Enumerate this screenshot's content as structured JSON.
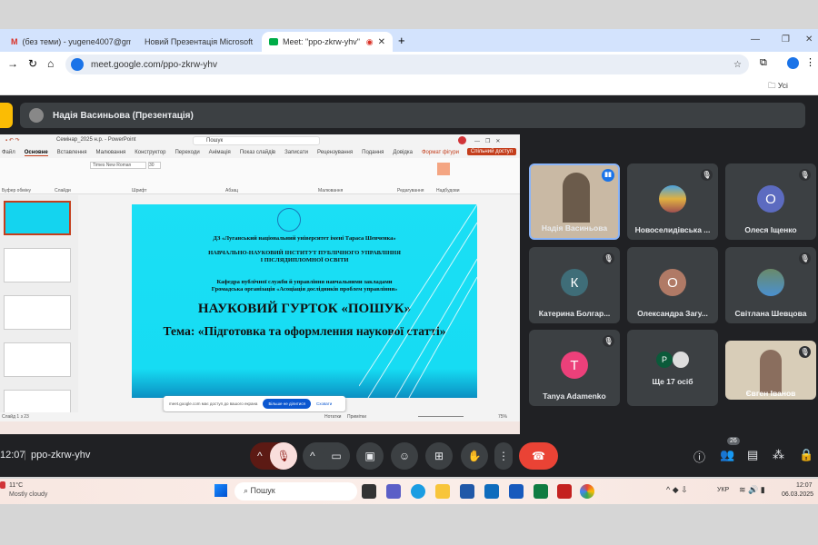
{
  "browser": {
    "tabs": [
      {
        "title": "(без теми) - yugene4007@gma",
        "icon": "gmail-icon"
      },
      {
        "title": "Новий Презентація Microsoft",
        "icon": "slides-icon"
      },
      {
        "title": "Meet: \"ppo-zkrw-yhv\"",
        "icon": "meet-icon",
        "active": true
      }
    ],
    "url": "meet.google.com/ppo-zkrw-yhv",
    "bookmarks_label": "Усі закладки"
  },
  "meet": {
    "presenter_label": "Надія Васиньова (Презентація)",
    "time": "12:07",
    "meeting_code": "ppo-zkrw-yhv",
    "participants_count": "26",
    "participants": [
      {
        "name": "Надія Васиньова",
        "type": "video",
        "speaking": true
      },
      {
        "name": "Новоселидівська ...",
        "type": "photo",
        "muted": true
      },
      {
        "name": "Олеся Іщенко",
        "initial": "О",
        "color": "#5c6bc0",
        "muted": true
      },
      {
        "name": "Катерина Болгар...",
        "initial": "К",
        "color": "#3f6d78",
        "muted": true
      },
      {
        "name": "Олександра Загу...",
        "initial": "О",
        "color": "#b07a66",
        "muted": false
      },
      {
        "name": "Світлана Шевцова",
        "type": "photo",
        "muted": true
      },
      {
        "name": "Tanya Adamenko",
        "initial": "T",
        "color": "#ec407a",
        "muted": true
      },
      {
        "name": "Ще 17 осіб",
        "initial": "P",
        "color": "#0b5a3a"
      },
      {
        "name": "Євген Іванов",
        "type": "video",
        "muted": true
      }
    ]
  },
  "ppt": {
    "title": "Семінар_2025 н.р. - PowerPoint",
    "search": "Пошук",
    "share_button": "Спільний доступ",
    "ribbon_tabs": [
      "Файл",
      "Основне",
      "Вставлення",
      "Малювання",
      "Конструктор",
      "Переходи",
      "Анімація",
      "Показ слайдів",
      "Записати",
      "Рецензування",
      "Подання",
      "Довідка",
      "Формат фігури"
    ],
    "font": "Times New Roman",
    "font_size": "30",
    "groups": [
      "Буфер обміну",
      "Слайди",
      "Шрифт",
      "Абзац",
      "Малювання",
      "Редагування",
      "Надбудови"
    ],
    "slide": {
      "line1": "ДЗ «Луганський національний університет імені Тараса Шевченка»",
      "line2": "НАВЧАЛЬНО-НАУКОВИЙ ІНСТИТУТ ПУБЛІЧНОГО УПРАВЛІННЯ",
      "line3": "І ПІСЛЯДИПЛОМНОЇ ОСВІТИ",
      "line4": "Кафедра публічної служби й управління навчальними закладами",
      "line5": "Громадська організація «Асоціація дослідників проблем управління»",
      "title": "НАУКОВИЙ ГУРТОК «ПОШУК»",
      "topic": "Тема: «Підготовка та оформлення наукової статті»"
    },
    "status": "Слайд 1 з 23",
    "zoom": "75%",
    "notes": "Нотатки",
    "comments": "Примітки",
    "notice": "meet.google.com має доступ до вашого екрана",
    "notice_stop": "Більше не ділитися",
    "notice_hide": "Сховати"
  },
  "taskbar": {
    "weather_temp": "11°C",
    "weather_text": "Mostly cloudy",
    "search": "Пошук",
    "lang": "УКР",
    "time": "12:07",
    "date": "06.03.2025"
  }
}
